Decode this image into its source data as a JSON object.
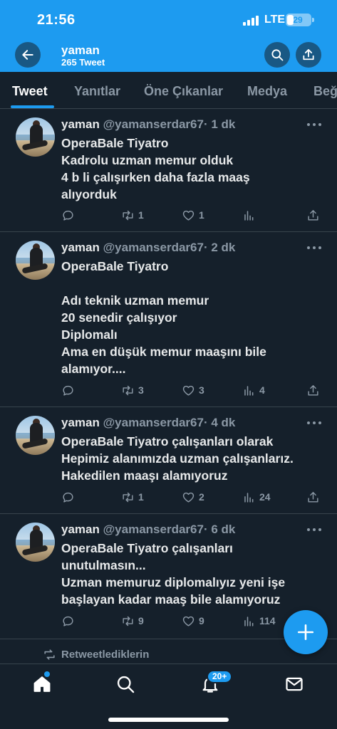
{
  "status_bar": {
    "time": "21:56",
    "network": "LTE",
    "battery": "29",
    "battery_level": 0.29
  },
  "header": {
    "name": "yaman",
    "tweet_count": "265 Tweet"
  },
  "tabs": [
    {
      "label": "Tweet",
      "active": true
    },
    {
      "label": "Yanıtlar",
      "active": false
    },
    {
      "label": "Öne Çıkanlar",
      "active": false
    },
    {
      "label": "Medya",
      "active": false
    },
    {
      "label": "Beğ",
      "active": false
    }
  ],
  "tweets": [
    {
      "name": "yaman",
      "handle": "@yamanserdar67",
      "time": "· 1 dk",
      "lines": [
        "OperaBale Tiyatro",
        "Kadrolu uzman memur olduk",
        "4 b li çalışırken daha fazla maaş",
        "alıyorduk"
      ],
      "replies": "",
      "retweets": "1",
      "likes": "1",
      "views": ""
    },
    {
      "name": "yaman",
      "handle": "@yamanserdar67",
      "time": "· 2 dk",
      "lines": [
        "OperaBale Tiyatro",
        "",
        "Adı teknik uzman memur",
        "20 senedir çalışıyor",
        "Diplomalı",
        "Ama en düşük memur maaşını bile",
        "alamıyor...."
      ],
      "replies": "",
      "retweets": "3",
      "likes": "3",
      "views": "4"
    },
    {
      "name": "yaman",
      "handle": "@yamanserdar67",
      "time": "· 4 dk",
      "lines": [
        "OperaBale Tiyatro çalışanları olarak",
        "Hepimiz alanımızda uzman çalışanlarız.",
        "Hakedilen maaşı alamıyoruz"
      ],
      "replies": "",
      "retweets": "1",
      "likes": "2",
      "views": "24"
    },
    {
      "name": "yaman",
      "handle": "@yamanserdar67",
      "time": "· 6 dk",
      "lines": [
        "OperaBale Tiyatro çalışanları",
        "unutulmasın...",
        "Uzman memuruz diplomalıyız yeni işe",
        "başlayan kadar maaş bile alamıyoruz"
      ],
      "replies": "",
      "retweets": "9",
      "likes": "9",
      "views": "114"
    }
  ],
  "retweeted_label": "Retweetlediklerin",
  "bottom_nav": {
    "notifications_badge": "20+"
  },
  "colors": {
    "accent": "#1d9bf0",
    "background": "#15202b",
    "muted": "#8b98a5",
    "divider": "#38444d"
  },
  "icons": [
    "back-arrow-icon",
    "search-icon",
    "share-icon",
    "more-icon",
    "reply-icon",
    "retweet-icon",
    "like-icon",
    "views-icon",
    "compose-plus-icon",
    "home-icon",
    "bell-icon",
    "mail-icon"
  ]
}
